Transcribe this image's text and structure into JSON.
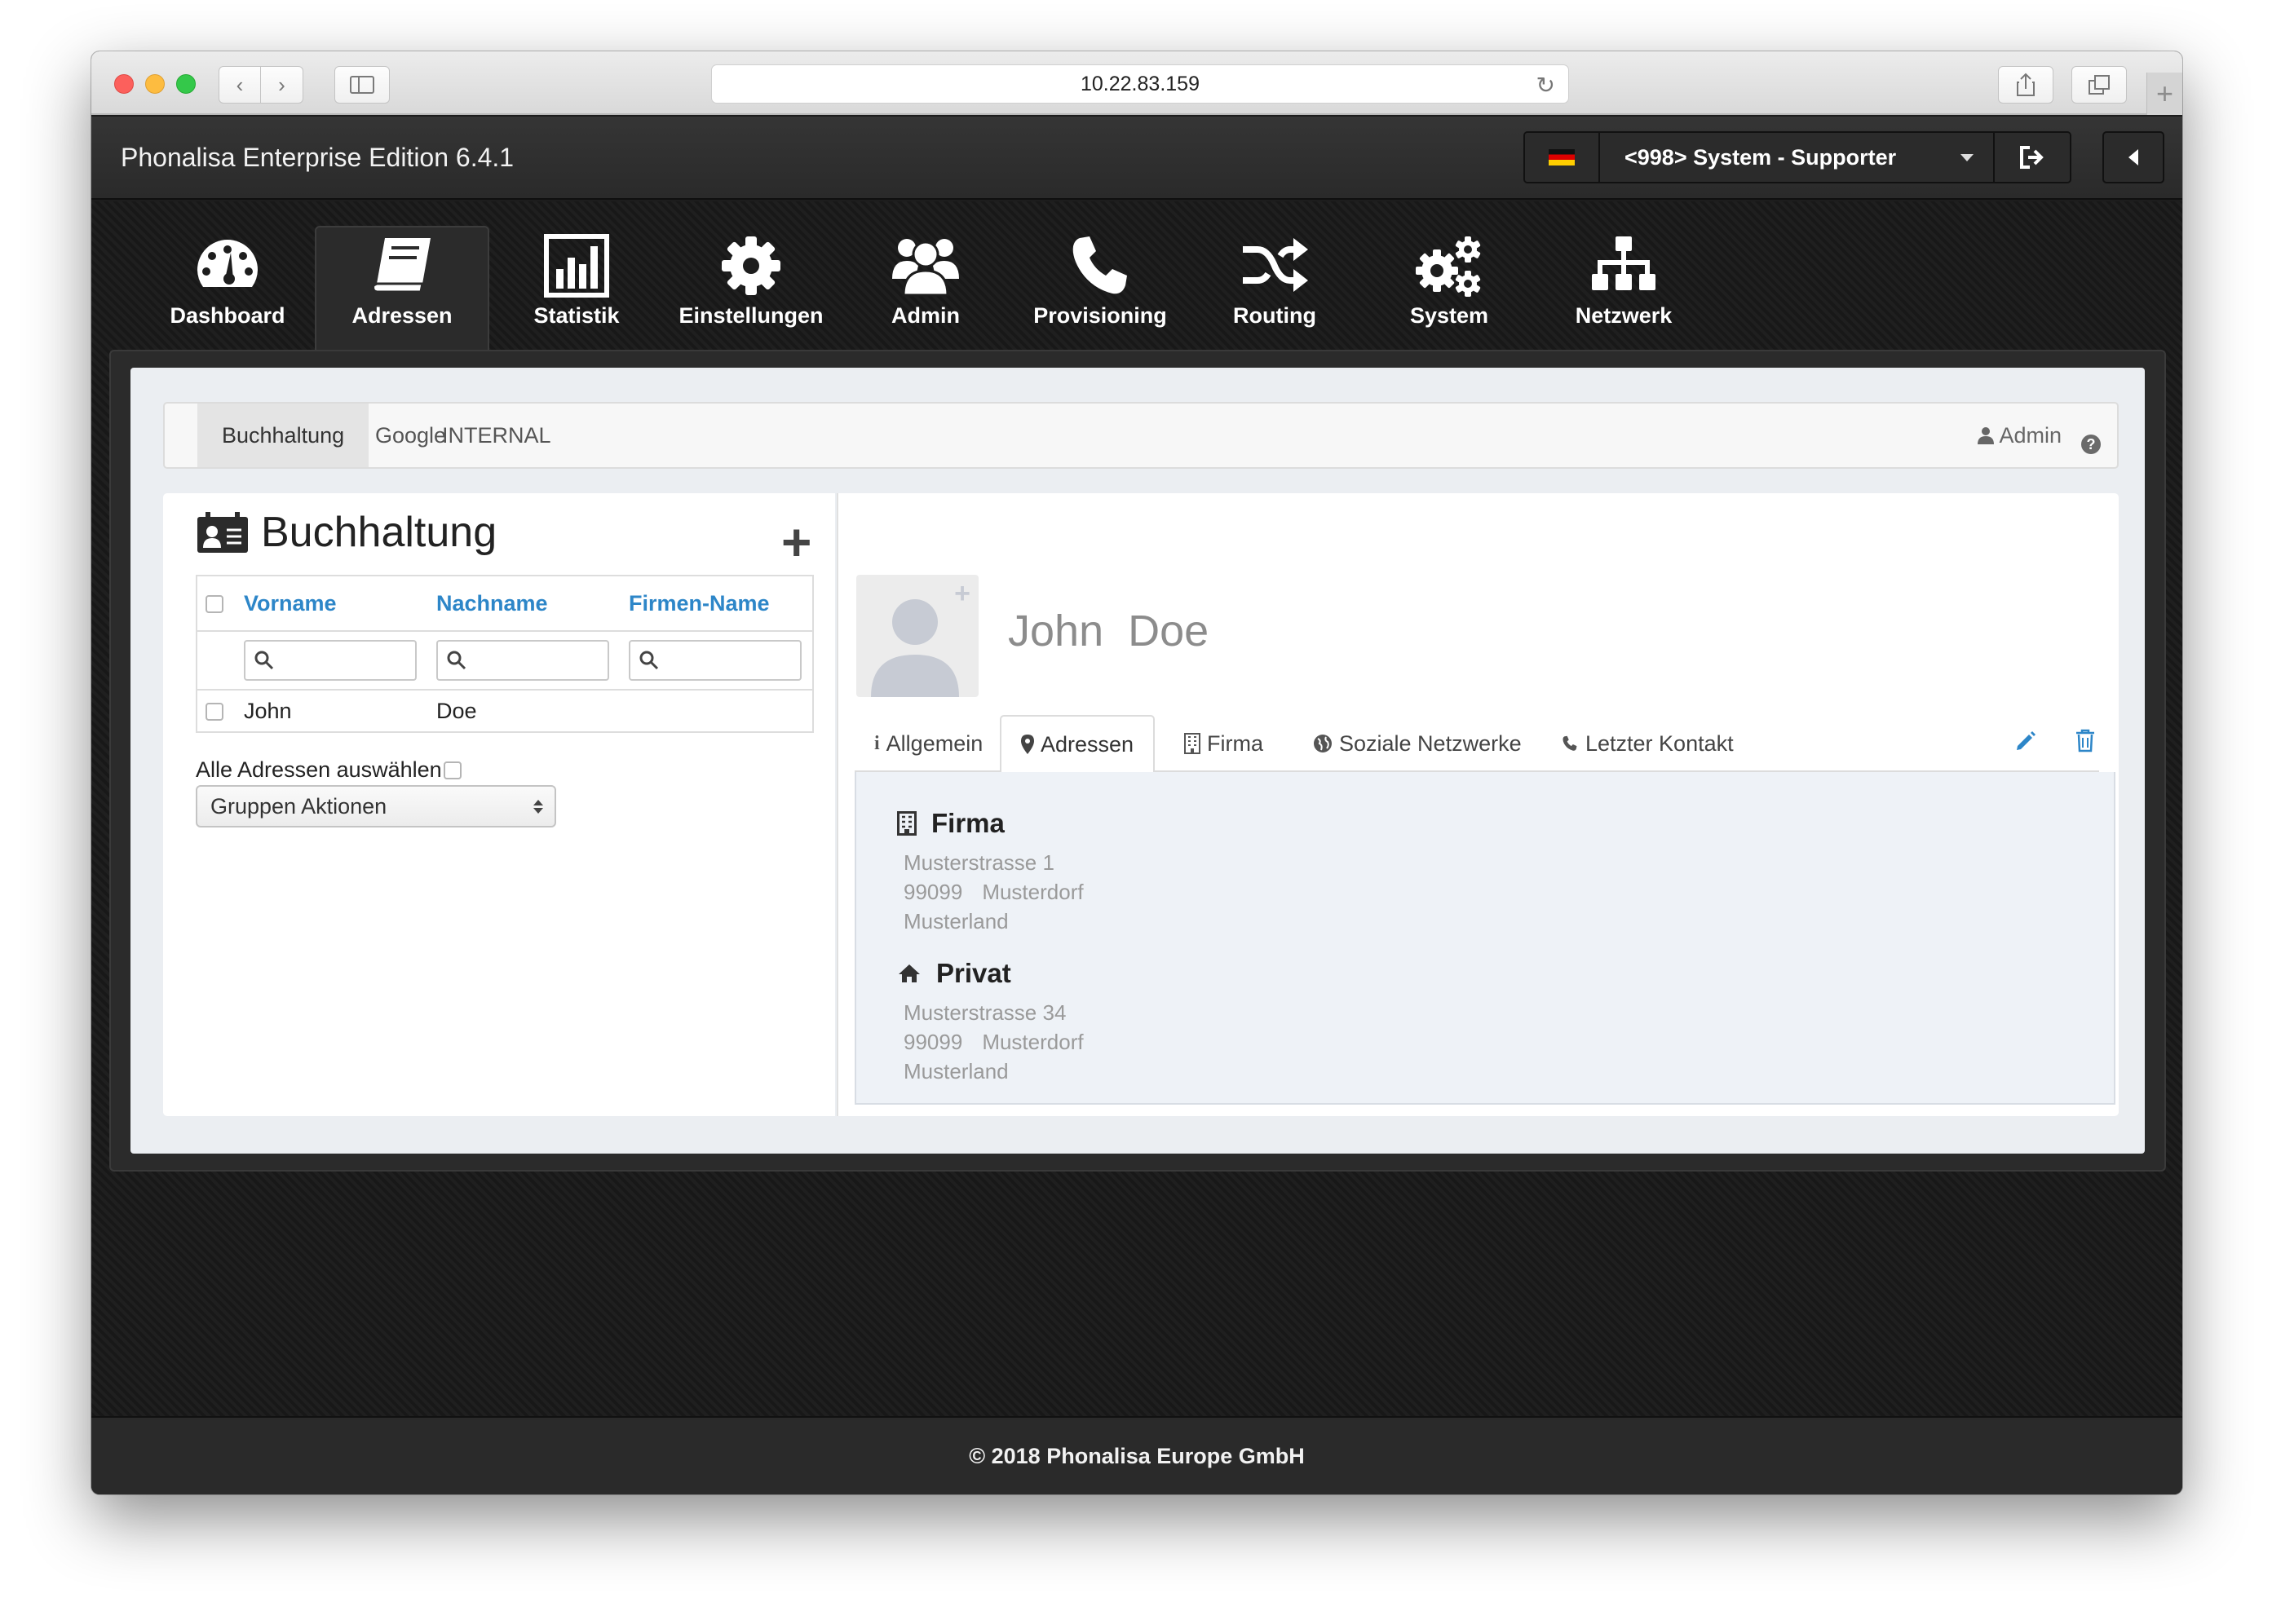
{
  "browser": {
    "url": "10.22.83.159"
  },
  "app": {
    "title": "Phonalisa Enterprise Edition 6.4.1",
    "user_label": "<998> System - Supporter"
  },
  "nav": {
    "items": [
      {
        "label": "Dashboard",
        "icon": "dashboard-gauge-icon"
      },
      {
        "label": "Adressen",
        "icon": "address-book-icon",
        "active": true
      },
      {
        "label": "Statistik",
        "icon": "bar-chart-icon"
      },
      {
        "label": "Einstellungen",
        "icon": "gear-icon"
      },
      {
        "label": "Admin",
        "icon": "users-icon"
      },
      {
        "label": "Provisioning",
        "icon": "phone-icon"
      },
      {
        "label": "Routing",
        "icon": "shuffle-icon"
      },
      {
        "label": "System",
        "icon": "gears-icon"
      },
      {
        "label": "Netzwerk",
        "icon": "sitemap-icon"
      }
    ]
  },
  "subtabs": {
    "items": [
      "Buchhaltung",
      "Google",
      "INTERNAL"
    ],
    "active": "Buchhaltung",
    "admin_label": "Admin",
    "help": "?"
  },
  "list": {
    "title": "Buchhaltung",
    "add": "+",
    "columns": [
      "Vorname",
      "Nachname",
      "Firmen-Name"
    ],
    "rows": [
      {
        "first": "John",
        "last": "Doe",
        "company": ""
      }
    ],
    "select_all_label": "Alle Adressen auswählen",
    "group_actions": "Gruppen Aktionen"
  },
  "contact": {
    "name": "John  Doe",
    "avatar_add": "+",
    "tabs": [
      {
        "label": "Allgemein",
        "icon": "info-icon"
      },
      {
        "label": "Adressen",
        "icon": "map-marker-icon",
        "active": true
      },
      {
        "label": "Firma",
        "icon": "building-icon"
      },
      {
        "label": "Soziale Netzwerke",
        "icon": "globe-icon"
      },
      {
        "label": "Letzter Kontakt",
        "icon": "phone-icon"
      }
    ],
    "addresses": [
      {
        "type": "Firma",
        "icon": "building-icon",
        "street": "Musterstrasse 1",
        "zip": "99099",
        "city": "Musterdorf",
        "country": "Musterland"
      },
      {
        "type": "Privat",
        "icon": "home-icon",
        "street": "Musterstrasse 34",
        "zip": "99099",
        "city": "Musterdorf",
        "country": "Musterland"
      }
    ]
  },
  "footer": {
    "copyright": "© 2018 Phonalisa Europe GmbH"
  },
  "colors": {
    "link_blue": "#2d86c8",
    "dark_bg": "#1d1d1d",
    "panel_bg": "#ebeef2"
  }
}
